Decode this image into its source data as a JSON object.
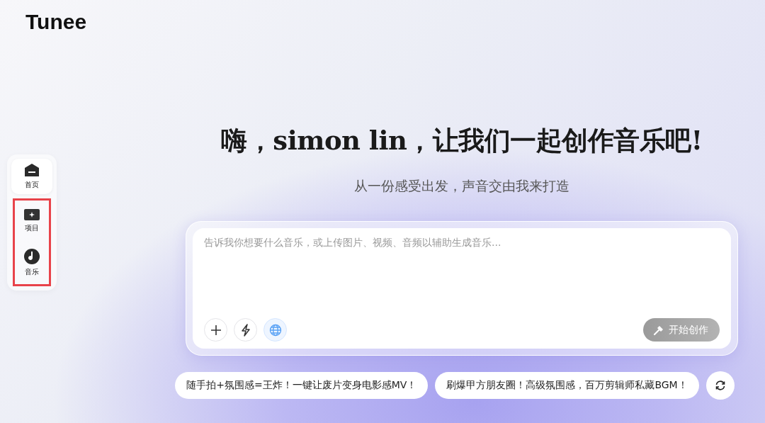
{
  "logo": "Tunee",
  "sidebar": {
    "items": [
      {
        "label": "首页",
        "kind": "home",
        "selected": true,
        "highlighted": false
      },
      {
        "label": "项目",
        "kind": "project",
        "selected": false,
        "highlighted": true
      },
      {
        "label": "音乐",
        "kind": "music",
        "selected": false,
        "highlighted": true
      }
    ]
  },
  "title": "嗨，simon lin，让我们一起创作音乐吧!",
  "subtitle": "从一份感受出发，声音交由我来打造",
  "prompt": {
    "placeholder": "告诉我你想要什么音乐，或上传图片、视频、音频以辅助生成音乐...",
    "tools": [
      {
        "kind": "plus",
        "active": false
      },
      {
        "kind": "bolt",
        "active": false
      },
      {
        "kind": "globe",
        "active": true
      }
    ],
    "submit": {
      "label": "开始创作",
      "disabled": true
    }
  },
  "suggestions": [
    "随手拍+氛围感=王炸！一键让废片变身电影感MV！",
    "刷爆甲方朋友圈！高级氛围感，百万剪辑师私藏BGM！"
  ]
}
